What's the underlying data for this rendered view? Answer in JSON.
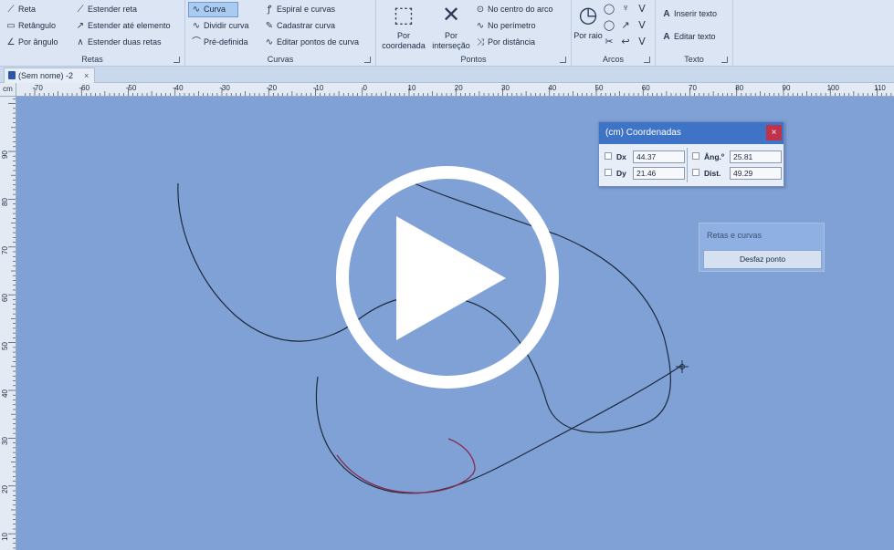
{
  "ribbon": {
    "retas": {
      "label": "Retas",
      "reta": "Reta",
      "retangulo": "Retângulo",
      "por_angulo": "Por ângulo",
      "estender_reta": "Estender reta",
      "estender_ate_elemento": "Estender até elemento",
      "estender_duas_retas": "Estender duas retas"
    },
    "curvas": {
      "label": "Curvas",
      "curva": "Curva",
      "dividir_curva": "Dividir curva",
      "pre_definida": "Pré-definida",
      "espiral_e_curvas": "Espiral e curvas",
      "cadastrar_curva": "Cadastrar curva",
      "editar_pontos_de_curva": "Editar pontos de curva"
    },
    "pontos": {
      "label": "Pontos",
      "por_coordenada": "Por coordenada",
      "por_intersecao": "Por interseção",
      "no_centro_do_arco": "No centro do arco",
      "no_perimetro": "No perímetro",
      "por_distancia": "Por distância"
    },
    "arcos": {
      "label": "Arcos",
      "por_raio": "Por raio"
    },
    "texto": {
      "label": "Texto",
      "inserir_texto": "Inserir texto",
      "editar_texto": "Editar texto"
    }
  },
  "doc_tab": {
    "title": "(Sem nome) -2",
    "close": "×"
  },
  "ruler": {
    "unit": "cm",
    "h_labels": [
      "-70",
      "-60",
      "-50",
      "-40",
      "-30",
      "-20",
      "-10",
      "0",
      "10",
      "20",
      "30",
      "40",
      "50",
      "60",
      "70",
      "80",
      "90",
      "100",
      "110"
    ],
    "v_labels": [
      "90",
      "80",
      "70",
      "60",
      "50",
      "40",
      "30",
      "20",
      "10"
    ]
  },
  "coord_dialog": {
    "title": "(cm) Coordenadas",
    "close": "×",
    "dx_label": "Dx",
    "dx_value": "44.37",
    "dy_label": "Dy",
    "dy_value": "21.46",
    "ang_label": "Âng.º",
    "ang_value": "25.81",
    "dist_label": "Dist.",
    "dist_value": "49.29"
  },
  "rc_panel": {
    "title": "Retas e curvas",
    "button": "Desfaz ponto"
  },
  "colors": {
    "canvas_bg": "#7fa1d6",
    "curve": "#1e2a3c",
    "curve_highlight": "#8a2a52",
    "titlebar": "#3f73c6",
    "close_red": "#c0324a"
  }
}
